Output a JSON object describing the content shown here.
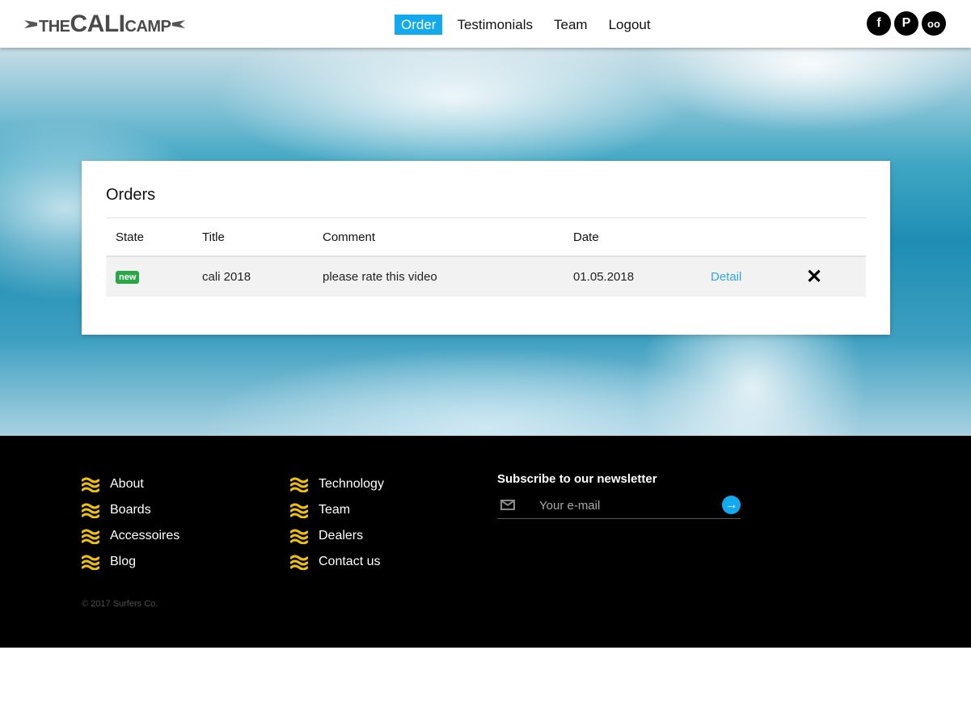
{
  "brand": {
    "logo_small_1": "THE",
    "logo_big": "CALI",
    "logo_small_2": "CAMP"
  },
  "nav": {
    "order": "Order",
    "testimonials": "Testimonials",
    "team": "Team",
    "logout": "Logout"
  },
  "social": {
    "facebook": "f",
    "pinterest": "P",
    "tripadvisor": "oo"
  },
  "orders": {
    "title": "Orders",
    "columns": {
      "state": "State",
      "title": "Title",
      "comment": "Comment",
      "date": "Date"
    },
    "rows": [
      {
        "state": "new",
        "title": "cali 2018",
        "comment": "please rate this video",
        "date": "01.05.2018",
        "action": "Detail",
        "delete_glyph": "✕"
      }
    ]
  },
  "footer": {
    "links_col1": [
      "About",
      "Boards",
      "Accessoires",
      "Blog"
    ],
    "links_col2": [
      "Technology",
      "Team",
      "Dealers",
      "Contact us"
    ],
    "newsletter": {
      "title": "Subscribe to our newsletter",
      "placeholder": "Your e-mail",
      "submit_glyph": "→"
    },
    "copyright": "© 2017 Surfers Co."
  },
  "colors": {
    "accent": "#12a9ee",
    "badge_green": "#27a844",
    "link": "#2ea7df",
    "wave_icon": "#f2c300",
    "footer_bg": "#000000"
  }
}
